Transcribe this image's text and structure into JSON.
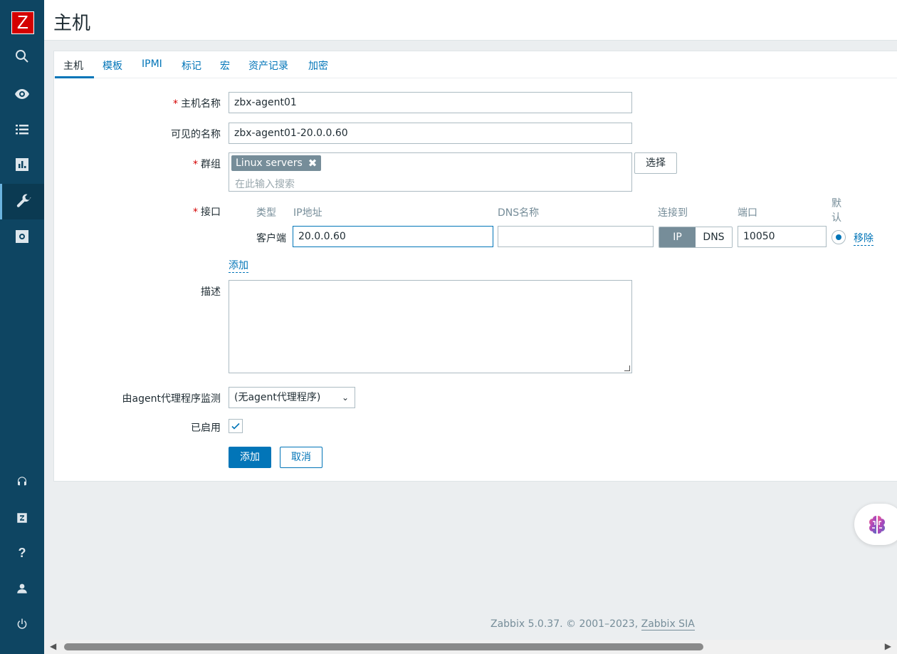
{
  "app": {
    "logo_letter": "Z"
  },
  "sidebar": {
    "items": [
      {
        "icon": "search-icon"
      },
      {
        "icon": "eye-icon"
      },
      {
        "icon": "list-icon"
      },
      {
        "icon": "bar-chart-icon"
      },
      {
        "icon": "wrench-icon",
        "active": true
      },
      {
        "icon": "gear-icon"
      }
    ],
    "bottom_items": [
      {
        "icon": "headset-icon"
      },
      {
        "icon": "zabbix-share-icon"
      },
      {
        "icon": "help-icon",
        "glyph": "?"
      },
      {
        "icon": "user-icon"
      },
      {
        "icon": "power-icon"
      }
    ]
  },
  "header": {
    "title": "主机"
  },
  "tabs": [
    "主机",
    "模板",
    "IPMI",
    "标记",
    "宏",
    "资产记录",
    "加密"
  ],
  "form": {
    "host_name_label": "主机名称",
    "host_name_value": "zbx-agent01",
    "visible_name_label": "可见的名称",
    "visible_name_value": "zbx-agent01-20.0.0.60",
    "groups_label": "群组",
    "group_tag": "Linux servers",
    "groups_placeholder": "在此输入搜索",
    "select_button": "选择",
    "interfaces_label": "接口",
    "interfaces": {
      "col_type": "类型",
      "col_ip": "IP地址",
      "col_dns": "DNS名称",
      "col_connect": "连接到",
      "col_port": "端口",
      "col_default": "默认",
      "row_type": "客户端",
      "row_ip": "20.0.0.60",
      "row_dns": "",
      "connect_ip": "IP",
      "connect_dns": "DNS",
      "row_port": "10050",
      "remove_link": "移除"
    },
    "add_link": "添加",
    "description_label": "描述",
    "description_value": "",
    "proxy_label": "由agent代理程序监测",
    "proxy_value": "(无agent代理程序)",
    "enabled_label": "已启用",
    "enabled": true,
    "add_button": "添加",
    "cancel_button": "取消"
  },
  "footer": {
    "text": "Zabbix 5.0.37. © 2001–2023, ",
    "link": "Zabbix SIA"
  },
  "colors": {
    "sidebar": "#0e4562",
    "accent": "#0275b8",
    "logo": "#d40000"
  }
}
